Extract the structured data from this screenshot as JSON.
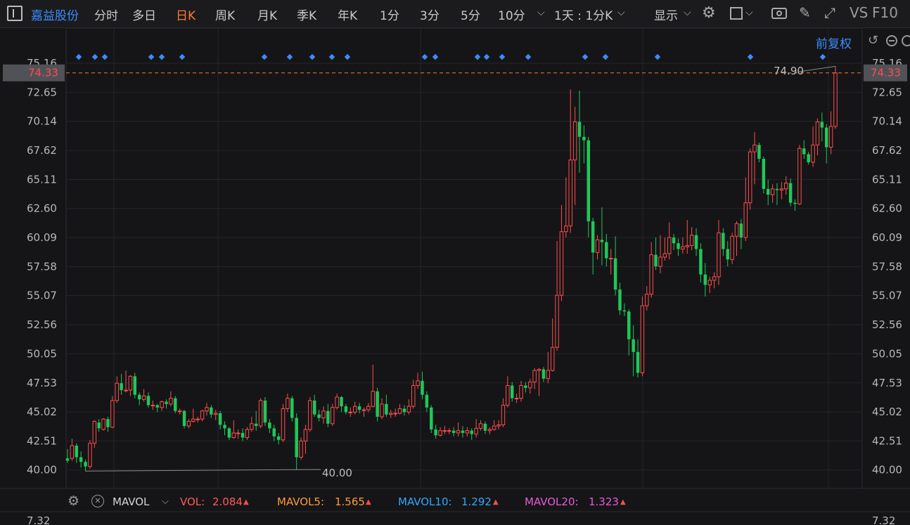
{
  "toolbar": {
    "stock_name": "嘉益股份",
    "tabs": [
      "分时",
      "多日",
      "日K",
      "周K",
      "月K",
      "季K",
      "年K",
      "1分",
      "3分",
      "5分",
      "10分"
    ],
    "active_tab": "日K",
    "period_select": "1天 : 1分K",
    "display_label": "显示",
    "right_labels": [
      "VS",
      "F10"
    ]
  },
  "chart_header": {
    "adjust_label": "前复权"
  },
  "price_axis": {
    "ticks": [
      "75.16",
      "72.65",
      "70.14",
      "67.62",
      "65.11",
      "62.60",
      "60.09",
      "57.58",
      "55.07",
      "52.56",
      "50.05",
      "47.53",
      "45.02",
      "42.51",
      "40.00"
    ],
    "current_price": "74.33",
    "high_label": "74.90",
    "low_label": "40.00"
  },
  "volume_axis": {
    "top_tick": "7.32"
  },
  "indicator": {
    "name": "MAVOL",
    "vol_label": "VOL:",
    "vol_value": "2.084",
    "mavol5_label": "MAVOL5:",
    "mavol5_value": "1.565",
    "mavol10_label": "MAVOL10:",
    "mavol10_value": "1.292",
    "mavol20_label": "MAVOL20:",
    "mavol20_value": "1.323"
  },
  "colors": {
    "up": "#ff4d4d",
    "down": "#1ec85a",
    "accent": "#ff7a2e",
    "blue": "#3d8bff",
    "mavol5": "#ff9a3c",
    "mavol10": "#2fa8ff",
    "mavol20": "#e85ad8"
  },
  "chart_data": {
    "type": "candlestick",
    "ylim": [
      38.4,
      76.5
    ],
    "candles": [
      [
        41.0,
        40.8,
        41.8,
        40.6
      ],
      [
        41.0,
        42.1,
        42.7,
        40.8
      ],
      [
        42.1,
        41.1,
        42.3,
        40.6
      ],
      [
        41.1,
        40.7,
        41.6,
        40.2
      ],
      [
        40.7,
        40.3,
        40.9,
        39.9
      ],
      [
        40.3,
        42.3,
        42.6,
        40.1
      ],
      [
        42.3,
        44.2,
        44.3,
        41.9
      ],
      [
        44.1,
        43.6,
        44.4,
        43.3
      ],
      [
        43.5,
        44.4,
        44.5,
        43.4
      ],
      [
        44.4,
        43.7,
        44.6,
        43.3
      ],
      [
        43.7,
        46.0,
        46.4,
        43.6
      ],
      [
        46.0,
        47.5,
        48.1,
        45.8
      ],
      [
        47.5,
        46.9,
        48.3,
        46.5
      ],
      [
        46.9,
        46.9,
        48.6,
        46.7
      ],
      [
        46.9,
        48.1,
        48.2,
        46.4
      ],
      [
        48.1,
        46.5,
        48.4,
        46.2
      ],
      [
        46.5,
        46.1,
        46.7,
        45.6
      ],
      [
        46.1,
        46.4,
        47.0,
        45.9
      ],
      [
        46.4,
        45.6,
        46.7,
        45.4
      ],
      [
        45.6,
        45.6,
        46.0,
        45.2
      ],
      [
        45.6,
        45.4,
        45.7,
        45.0
      ],
      [
        45.4,
        45.9,
        46.0,
        45.1
      ],
      [
        45.9,
        45.7,
        46.1,
        45.3
      ],
      [
        45.7,
        46.2,
        46.8,
        45.5
      ],
      [
        46.2,
        45.1,
        46.4,
        44.9
      ],
      [
        45.1,
        45.1,
        45.3,
        44.8
      ],
      [
        45.1,
        43.8,
        45.2,
        43.6
      ],
      [
        43.8,
        44.2,
        44.4,
        43.6
      ],
      [
        44.2,
        44.4,
        45.3,
        44.1
      ],
      [
        44.4,
        44.4,
        44.6,
        44.1
      ],
      [
        44.4,
        45.1,
        45.2,
        44.2
      ],
      [
        45.1,
        45.4,
        45.8,
        44.7
      ],
      [
        45.4,
        44.8,
        45.6,
        44.5
      ],
      [
        44.8,
        44.9,
        45.2,
        44.3
      ],
      [
        44.9,
        43.9,
        45.1,
        43.5
      ],
      [
        43.9,
        43.6,
        44.2,
        43.0
      ],
      [
        43.6,
        42.8,
        43.7,
        42.6
      ],
      [
        42.8,
        43.2,
        44.3,
        42.7
      ],
      [
        43.2,
        43.2,
        43.5,
        42.7
      ],
      [
        43.2,
        42.8,
        43.6,
        42.5
      ],
      [
        42.8,
        43.5,
        43.7,
        42.6
      ],
      [
        43.5,
        44.0,
        44.6,
        43.3
      ],
      [
        44.0,
        43.8,
        45.1,
        43.4
      ],
      [
        43.8,
        46.0,
        46.2,
        43.6
      ],
      [
        46.0,
        44.1,
        46.3,
        43.8
      ],
      [
        44.1,
        43.6,
        44.4,
        43.2
      ],
      [
        43.6,
        42.9,
        43.9,
        42.5
      ],
      [
        42.9,
        42.6,
        43.2,
        42.2
      ],
      [
        42.6,
        45.3,
        45.7,
        42.4
      ],
      [
        45.3,
        46.2,
        46.6,
        45.0
      ],
      [
        46.2,
        44.5,
        46.4,
        44.2
      ],
      [
        44.5,
        41.1,
        44.9,
        40.0
      ],
      [
        41.1,
        42.5,
        42.8,
        40.9
      ],
      [
        42.5,
        43.5,
        43.9,
        41.4
      ],
      [
        43.5,
        46.0,
        46.3,
        43.3
      ],
      [
        46.0,
        44.8,
        46.5,
        44.6
      ],
      [
        44.8,
        44.5,
        45.2,
        44.2
      ],
      [
        44.5,
        45.1,
        45.5,
        44.0
      ],
      [
        45.1,
        44.0,
        45.7,
        43.7
      ],
      [
        44.0,
        45.4,
        45.7,
        43.8
      ],
      [
        45.4,
        46.3,
        46.6,
        45.2
      ],
      [
        46.3,
        45.5,
        46.4,
        45.0
      ],
      [
        45.5,
        45.0,
        45.7,
        44.8
      ],
      [
        45.0,
        45.0,
        45.4,
        44.6
      ],
      [
        45.0,
        45.5,
        45.9,
        44.8
      ],
      [
        45.5,
        45.2,
        45.8,
        44.9
      ],
      [
        45.2,
        45.2,
        45.4,
        44.6
      ],
      [
        45.2,
        45.5,
        45.8,
        45.0
      ],
      [
        45.5,
        46.8,
        49.1,
        45.4
      ],
      [
        46.8,
        44.6,
        47.1,
        44.2
      ],
      [
        44.6,
        45.7,
        46.2,
        44.4
      ],
      [
        45.7,
        44.8,
        46.5,
        44.6
      ],
      [
        44.8,
        44.9,
        45.2,
        44.5
      ],
      [
        44.9,
        44.9,
        45.3,
        44.6
      ],
      [
        44.9,
        45.3,
        45.7,
        44.8
      ],
      [
        45.3,
        45.0,
        45.6,
        44.7
      ],
      [
        45.0,
        45.5,
        46.1,
        44.8
      ],
      [
        45.5,
        47.3,
        47.8,
        45.3
      ],
      [
        47.3,
        47.7,
        48.4,
        47.0
      ],
      [
        47.7,
        46.5,
        48.5,
        46.1
      ],
      [
        46.5,
        45.4,
        46.8,
        45.0
      ],
      [
        45.4,
        43.5,
        45.6,
        43.2
      ],
      [
        43.5,
        43.0,
        43.9,
        42.7
      ],
      [
        43.0,
        43.4,
        43.7,
        42.9
      ],
      [
        43.4,
        43.4,
        43.8,
        43.1
      ],
      [
        43.4,
        43.4,
        43.6,
        43.1
      ],
      [
        43.4,
        43.2,
        43.7,
        42.9
      ],
      [
        43.2,
        43.4,
        44.1,
        42.9
      ],
      [
        43.4,
        43.2,
        43.8,
        42.8
      ],
      [
        43.2,
        43.4,
        43.7,
        42.9
      ],
      [
        43.4,
        43.1,
        43.6,
        42.6
      ],
      [
        43.1,
        43.6,
        44.4,
        42.8
      ],
      [
        43.6,
        44.0,
        44.3,
        43.4
      ],
      [
        44.0,
        43.4,
        44.2,
        43.1
      ],
      [
        43.4,
        43.5,
        43.7,
        43.1
      ],
      [
        43.5,
        43.8,
        44.3,
        43.4
      ],
      [
        43.8,
        43.9,
        44.3,
        43.5
      ],
      [
        43.9,
        45.6,
        46.2,
        43.7
      ],
      [
        45.6,
        47.3,
        48.1,
        45.4
      ],
      [
        47.3,
        46.2,
        47.6,
        45.9
      ],
      [
        46.2,
        46.2,
        46.6,
        45.8
      ],
      [
        46.2,
        47.3,
        47.7,
        45.9
      ],
      [
        47.3,
        47.1,
        47.6,
        46.7
      ],
      [
        47.1,
        47.6,
        47.9,
        46.6
      ],
      [
        47.6,
        48.6,
        48.8,
        47.0
      ],
      [
        48.6,
        48.7,
        48.8,
        46.4
      ],
      [
        48.7,
        47.9,
        48.9,
        47.6
      ],
      [
        47.9,
        48.6,
        50.2,
        47.5
      ],
      [
        48.6,
        50.6,
        53.1,
        48.5
      ],
      [
        50.6,
        55.1,
        59.8,
        50.3
      ],
      [
        55.1,
        60.6,
        62.9,
        54.6
      ],
      [
        60.6,
        61.1,
        65.3,
        60.1
      ],
      [
        61.1,
        66.8,
        72.9,
        60.5
      ],
      [
        66.8,
        70.1,
        71.4,
        62.9
      ],
      [
        70.1,
        68.8,
        72.8,
        65.7
      ],
      [
        68.8,
        68.5,
        69.8,
        66.5
      ],
      [
        68.5,
        61.5,
        68.8,
        60.1
      ],
      [
        61.5,
        58.8,
        61.8,
        56.9
      ],
      [
        58.8,
        59.9,
        60.3,
        58.2
      ],
      [
        59.9,
        59.7,
        62.7,
        57.7
      ],
      [
        59.7,
        58.3,
        60.4,
        57.6
      ],
      [
        58.3,
        58.3,
        59.1,
        56.9
      ],
      [
        58.3,
        55.6,
        60.2,
        55.1
      ],
      [
        55.6,
        53.8,
        56.2,
        53.4
      ],
      [
        53.8,
        53.7,
        54.4,
        53.3
      ],
      [
        53.7,
        51.3,
        53.9,
        49.9
      ],
      [
        51.3,
        50.2,
        52.5,
        48.1
      ],
      [
        50.2,
        48.4,
        51.3,
        48.0
      ],
      [
        48.4,
        54.2,
        55.0,
        48.1
      ],
      [
        54.2,
        55.2,
        55.9,
        53.8
      ],
      [
        55.2,
        58.6,
        59.7,
        54.9
      ],
      [
        58.6,
        57.6,
        60.1,
        57.3
      ],
      [
        57.6,
        58.4,
        60.3,
        57.0
      ],
      [
        58.4,
        58.7,
        60.1,
        58.1
      ],
      [
        58.7,
        60.1,
        61.4,
        58.2
      ],
      [
        60.1,
        59.6,
        60.4,
        59.0
      ],
      [
        59.6,
        59.1,
        60.0,
        58.5
      ],
      [
        59.1,
        59.3,
        60.1,
        58.7
      ],
      [
        59.3,
        59.4,
        61.6,
        58.7
      ],
      [
        59.4,
        60.3,
        61.0,
        59.0
      ],
      [
        60.3,
        59.1,
        60.9,
        58.5
      ],
      [
        59.1,
        56.9,
        59.6,
        56.2
      ],
      [
        56.9,
        56.0,
        57.9,
        55.0
      ],
      [
        56.0,
        56.4,
        56.7,
        55.3
      ],
      [
        56.4,
        56.7,
        57.1,
        55.7
      ],
      [
        56.7,
        60.5,
        61.6,
        56.0
      ],
      [
        60.5,
        59.1,
        60.9,
        58.5
      ],
      [
        59.1,
        58.2,
        59.8,
        57.6
      ],
      [
        58.2,
        60.2,
        60.5,
        57.8
      ],
      [
        60.2,
        61.3,
        61.5,
        58.5
      ],
      [
        61.3,
        60.1,
        61.7,
        59.1
      ],
      [
        60.1,
        63.1,
        65.3,
        59.8
      ],
      [
        63.1,
        67.5,
        67.8,
        62.5
      ],
      [
        67.5,
        68.1,
        69.2,
        64.7
      ],
      [
        68.1,
        66.9,
        68.3,
        66.6
      ],
      [
        66.9,
        64.3,
        67.1,
        63.9
      ],
      [
        64.3,
        63.8,
        65.1,
        62.9
      ],
      [
        63.8,
        64.3,
        64.7,
        63.1
      ],
      [
        64.3,
        64.2,
        64.8,
        62.9
      ],
      [
        64.2,
        64.3,
        64.9,
        63.4
      ],
      [
        64.3,
        64.8,
        65.4,
        63.8
      ],
      [
        64.8,
        63.1,
        65.2,
        62.8
      ],
      [
        63.1,
        63.0,
        63.4,
        62.4
      ],
      [
        63.0,
        67.8,
        68.1,
        62.9
      ],
      [
        67.8,
        67.3,
        68.5,
        66.9
      ],
      [
        67.3,
        66.6,
        67.5,
        66.4
      ],
      [
        66.6,
        68.1,
        69.7,
        66.2
      ],
      [
        68.1,
        70.1,
        70.4,
        67.2
      ],
      [
        70.1,
        69.6,
        70.9,
        68.4
      ],
      [
        69.6,
        67.9,
        69.9,
        66.5
      ],
      [
        67.9,
        69.7,
        71.0,
        67.3
      ],
      [
        69.7,
        74.33,
        74.9,
        69.5
      ]
    ]
  }
}
